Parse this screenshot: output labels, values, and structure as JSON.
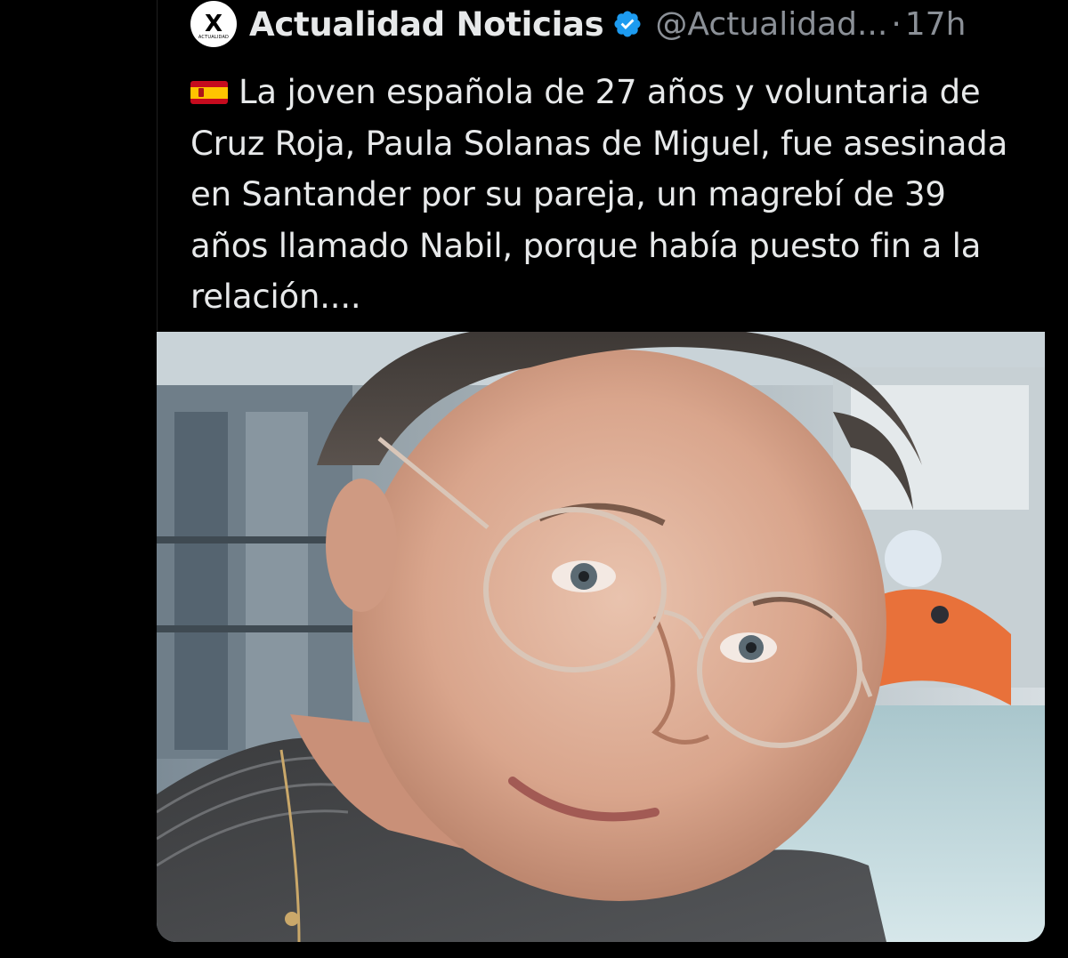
{
  "post": {
    "account_name": "Actualidad Noticias",
    "avatar_letter": "X",
    "avatar_caption": "ACTUALIDAD",
    "handle": "@Actualidad...",
    "separator": "·",
    "time": "17h",
    "verified": true,
    "verified_color": "#1d9bf0",
    "flag_icon": "spain-flag-icon",
    "text": "La joven española de 27 años y voluntaria de Cruz Roja, Paula Solanas de Miguel, fue asesinada en Santander por su pareja, un magrebí de 39 años llamado Nabil, porque había puesto fin a la relación....",
    "media_icon": "photo-image"
  },
  "colors": {
    "background": "#000000",
    "text_primary": "#e7e9ea",
    "text_secondary": "#8b9097"
  }
}
